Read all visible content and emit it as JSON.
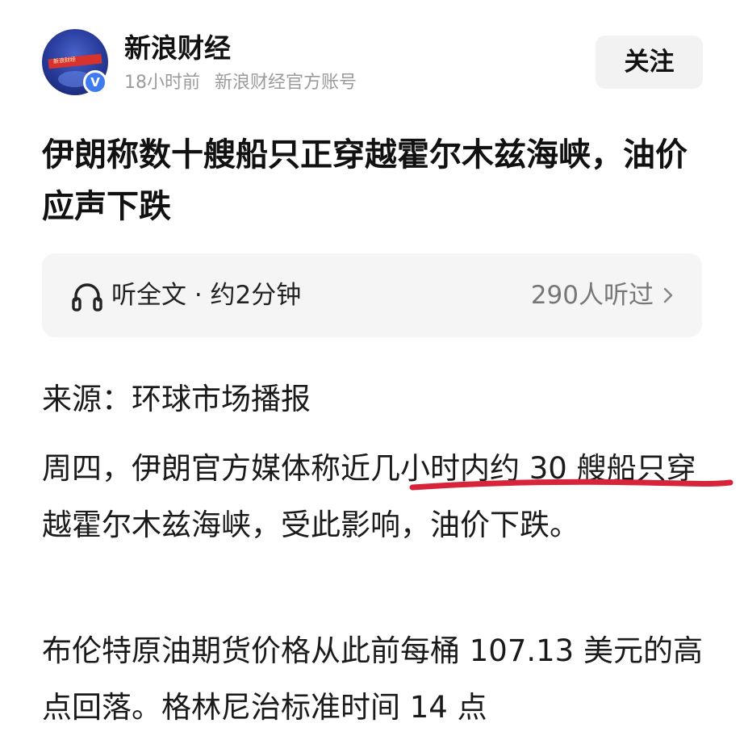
{
  "account": {
    "name": "新浪财经",
    "time_ago": "18小时前",
    "description": "新浪财经官方账号",
    "badge": "V",
    "avatar_banner_text": "新浪财经"
  },
  "follow_button": {
    "label": "关注"
  },
  "article": {
    "title": "伊朗称数十艘船只正穿越霍尔木兹海峡，油价应声下跌"
  },
  "listen_bar": {
    "label": "听全文 · 约2分钟",
    "count": "290人听过",
    "icon": "headphone-icon",
    "chevron": "chevron-right-icon"
  },
  "content": {
    "source": "来源：环球市场播报",
    "paragraph_1": "周四，伊朗官方媒体称近几小时内约 30 艘船只穿越霍尔木兹海峡，受此影响，油价下跌。",
    "paragraph_2": "布伦特原油期货价格从此前每桶 107.13 美元的高点回落。格林尼治标准时间 14 点"
  },
  "colors": {
    "accent_badge": "#3f7bf0",
    "highlight_underline": "#d8243a",
    "follow_bg": "#f2f2f2",
    "listen_bg": "#f5f5f5"
  }
}
